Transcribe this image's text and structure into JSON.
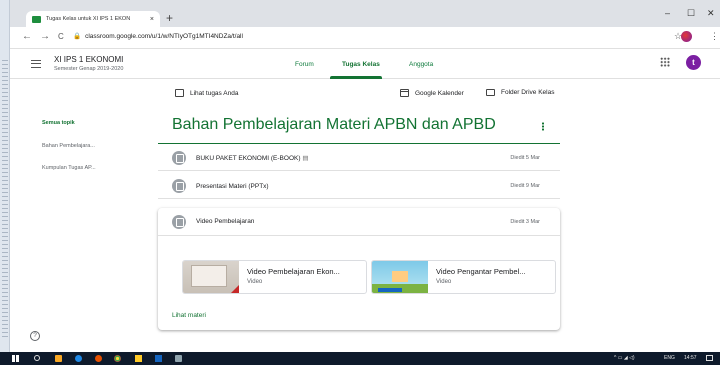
{
  "browser": {
    "tab_title": "Tugas Kelas untuk XI IPS 1 EKON",
    "tab_close": "×",
    "new_tab": "+",
    "window_controls": [
      "–",
      "☐",
      "✕"
    ],
    "nav": [
      "←",
      "→",
      "C"
    ],
    "url": "classroom.google.com/u/1/w/NTIyOTg1MTI4NDZa/t/all",
    "star": "☆",
    "menu": "⋮"
  },
  "header": {
    "class_name": "XI IPS 1 EKONOMI",
    "semester": "Semester Genap 2019-2020",
    "tabs": [
      {
        "label": "Forum"
      },
      {
        "label": "Tugas Kelas"
      },
      {
        "label": "Anggota"
      }
    ],
    "avatar_letter": "t"
  },
  "toolbar": {
    "view_work": "Lihat tugas Anda",
    "calendar": "Google Kalender",
    "drive": "Folder Drive Kelas"
  },
  "sidebar": {
    "items": [
      {
        "label": "Semua topik"
      },
      {
        "label": "Bahan Pembelajara..."
      },
      {
        "label": "Kumpulan Tugas AP..."
      }
    ]
  },
  "topic": {
    "title": "Bahan Pembelajaran Materi APBN dan APBD",
    "materials": [
      {
        "title": "BUKU PAKET EKONOMI (E-BOOK)",
        "posted": "Diedit 5 Mar"
      },
      {
        "title": "Presentasi Materi (PPTx)",
        "posted": "Diedit 9 Mar"
      }
    ],
    "expanded": {
      "title": "Video Pembelajaran",
      "posted": "Diedit 3 Mar",
      "attachments": [
        {
          "title": "Video Pembelajaran Ekon...",
          "type": "Video"
        },
        {
          "title": "Video Pengantar Pembel...",
          "type": "Video"
        }
      ],
      "view_link": "Lihat materi"
    }
  },
  "help": "?",
  "taskbar": {
    "lang": "ENG",
    "time": "14:57"
  }
}
